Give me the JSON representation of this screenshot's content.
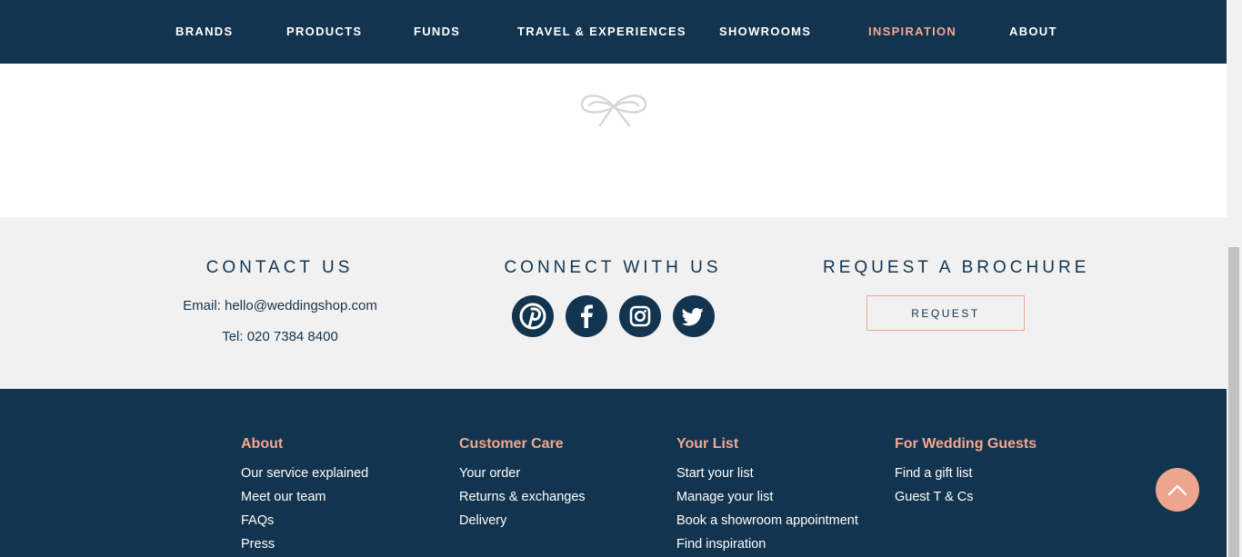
{
  "nav": {
    "items": [
      {
        "label": "BRANDS",
        "active": false
      },
      {
        "label": "PRODUCTS",
        "active": false
      },
      {
        "label": "FUNDS",
        "active": false
      },
      {
        "label": "TRAVEL & EXPERIENCES",
        "active": false
      },
      {
        "label": "SHOWROOMS",
        "active": false
      },
      {
        "label": "INSPIRATION",
        "active": true
      },
      {
        "label": "ABOUT",
        "active": false
      }
    ]
  },
  "contact": {
    "title": "CONTACT US",
    "email": "Email: hello@weddingshop.com",
    "tel": "Tel: 020 7384 8400"
  },
  "connect": {
    "title": "CONNECT WITH US",
    "icons": [
      "pinterest-icon",
      "facebook-icon",
      "instagram-icon",
      "twitter-icon"
    ]
  },
  "brochure": {
    "title": "REQUEST A BROCHURE",
    "button_label": "REQUEST"
  },
  "footer": {
    "columns": [
      {
        "heading": "About",
        "links": [
          "Our service explained",
          "Meet our team",
          "FAQs",
          "Press"
        ]
      },
      {
        "heading": "Customer Care",
        "links": [
          "Your order",
          "Returns & exchanges",
          "Delivery"
        ]
      },
      {
        "heading": "Your List",
        "links": [
          "Start your list",
          "Manage your list",
          "Book a showroom appointment",
          "Find inspiration"
        ]
      },
      {
        "heading": "For Wedding Guests",
        "links": [
          "Find a gift list",
          "Guest T & Cs"
        ]
      }
    ]
  },
  "colors": {
    "navy": "#13344f",
    "accent": "#f1a88f",
    "band": "#f1f1f1"
  }
}
